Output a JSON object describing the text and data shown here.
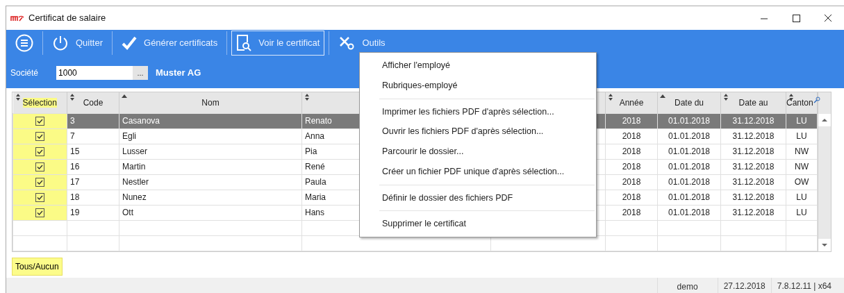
{
  "window": {
    "title": "Certificat de salaire"
  },
  "toolbar": [
    {
      "kind": "menu",
      "selected": false
    },
    {
      "kind": "power",
      "label": "Quitter",
      "selected": false
    },
    {
      "kind": "check",
      "label": "Générer certificats",
      "selected": false
    },
    {
      "kind": "preview",
      "label": "Voir le certificat",
      "selected": true
    },
    {
      "kind": "tools",
      "label": "Outils",
      "selected": false
    }
  ],
  "company": {
    "label": "Société",
    "value": "1000",
    "browse": "...",
    "name": "Muster AG"
  },
  "table": {
    "selection_column": {
      "label": "Sélection",
      "sorted": false,
      "highlighted": true
    },
    "columns": [
      {
        "label": "Code",
        "sorted": false
      },
      {
        "label": "Nom",
        "sorted": true
      },
      {
        "sorted": false
      },
      {
        "label": "Année",
        "sorted": false
      },
      {
        "label": "Date du",
        "sorted": true
      },
      {
        "label": "Date au",
        "sorted": false
      },
      {
        "label": "Canton",
        "sorted": false
      }
    ],
    "rows": [
      {
        "selected": true,
        "checked": true,
        "cells": [
          "3",
          "Casanova",
          "Renato",
          "2018",
          "01.01.2018",
          "31.12.2018",
          "LU"
        ]
      },
      {
        "selected": false,
        "checked": true,
        "cells": [
          "7",
          "Egli",
          "Anna",
          "2018",
          "01.01.2018",
          "31.12.2018",
          "LU"
        ]
      },
      {
        "selected": false,
        "checked": true,
        "cells": [
          "15",
          "Lusser",
          "Pia",
          "2018",
          "01.01.2018",
          "31.12.2018",
          "NW"
        ]
      },
      {
        "selected": false,
        "checked": true,
        "cells": [
          "16",
          "Martin",
          "René",
          "2018",
          "01.01.2018",
          "31.12.2018",
          "NW"
        ]
      },
      {
        "selected": false,
        "checked": true,
        "cells": [
          "17",
          "Nestler",
          "Paula",
          "2018",
          "01.01.2018",
          "31.12.2018",
          "OW"
        ]
      },
      {
        "selected": false,
        "checked": true,
        "cells": [
          "18",
          "Nunez",
          "Maria",
          "2018",
          "01.01.2018",
          "31.12.2018",
          "LU"
        ]
      },
      {
        "selected": false,
        "checked": true,
        "cells": [
          "19",
          "Ott",
          "Hans",
          "2018",
          "01.01.2018",
          "31.12.2018",
          "LU"
        ]
      }
    ]
  },
  "context_menu": [
    {
      "items": [
        "Afficher l'employé",
        "Rubriques-employé"
      ]
    },
    {
      "items": [
        "Imprimer les fichiers PDF d'après sélection...",
        "Ouvrir les fichiers PDF d'après sélection...",
        "Parcourir le dossier...",
        "Créer un fichier PDF unique d'après sélection..."
      ]
    },
    {
      "items": [
        "Définir le dossier des fichiers PDF"
      ]
    },
    {
      "items": [
        "Supprimer le certificat"
      ]
    }
  ],
  "toggle_button": {
    "label": "Tous/Aucun",
    "highlighted": true
  },
  "status_bar": [
    "demo",
    "27.12.2018",
    "7.8.12.11 | x64"
  ]
}
